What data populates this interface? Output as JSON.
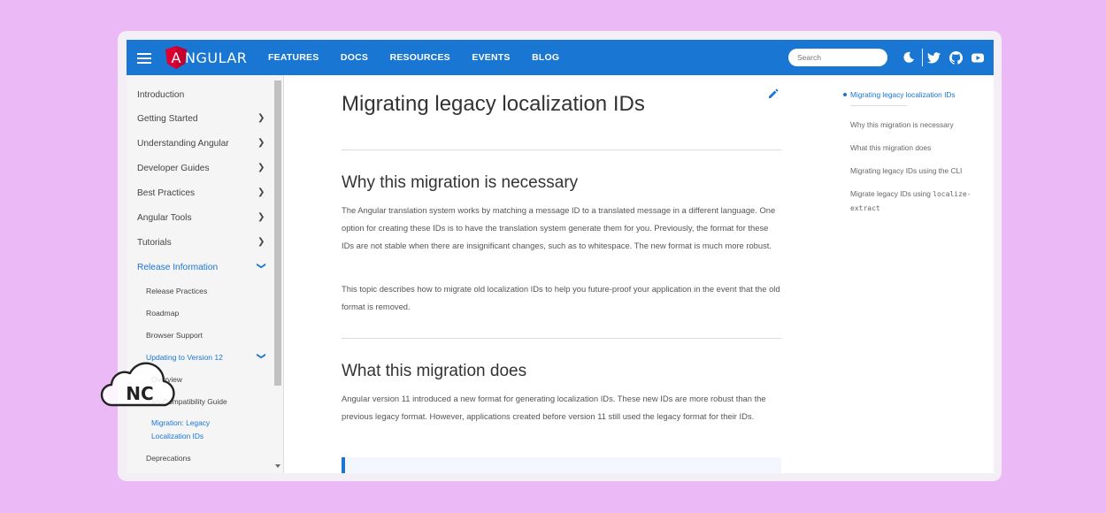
{
  "brand": {
    "text": "NGULAR",
    "shield_letter": "A",
    "color": "#dd0031"
  },
  "nav": [
    "FEATURES",
    "DOCS",
    "RESOURCES",
    "EVENTS",
    "BLOG"
  ],
  "search": {
    "placeholder": "Search"
  },
  "top_icons": [
    "moon-icon",
    "twitter-icon",
    "github-icon",
    "youtube-icon"
  ],
  "sidebar": {
    "items": [
      {
        "label": "Introduction",
        "chevron": false
      },
      {
        "label": "Getting Started",
        "chevron": true
      },
      {
        "label": "Understanding Angular",
        "chevron": true
      },
      {
        "label": "Developer Guides",
        "chevron": true
      },
      {
        "label": "Best Practices",
        "chevron": true
      },
      {
        "label": "Angular Tools",
        "chevron": true
      },
      {
        "label": "Tutorials",
        "chevron": true
      },
      {
        "label": "Release Information",
        "chevron": "expanded",
        "active": true
      }
    ],
    "release_sub": [
      "Release Practices",
      "Roadmap",
      "Browser Support",
      "Updating to Version 12"
    ],
    "updating_sub": [
      "Overview",
      "Ivy Compatibility Guide",
      "Migration: Legacy",
      "Localization IDs"
    ],
    "after": [
      "Deprecations"
    ]
  },
  "content": {
    "title": "Migrating legacy localization IDs",
    "s1_title": "Why this migration is necessary",
    "s1_p1": "The Angular translation system works by matching a message ID to a translated message in a different language. One option for creating these IDs is to have the translation system generate them for you. Previously, the format for these IDs are not stable when there are insignificant changes, such as to whitespace. The new format is much more robust.",
    "s1_p2": "This topic describes how to migrate old localization IDs to help you future-proof your application in the event that the old format is removed.",
    "s2_title": "What this migration does",
    "s2_p1": "Angular version 11 introduced a new format for generating localization IDs. These new IDs are more robust than the previous legacy format. However, applications created before version 11 still used the legacy format for their IDs."
  },
  "toc": {
    "items": [
      "Migrating legacy localization IDs",
      "Why this migration is necessary",
      "What this migration does",
      "Migrating legacy IDs using the CLI",
      "Migrate legacy IDs using"
    ],
    "code_a": "localize-",
    "code_b": "extract"
  },
  "watermark": {
    "text": "NC"
  },
  "colors": {
    "accent": "#1976d2",
    "background": "#eab9f6"
  }
}
